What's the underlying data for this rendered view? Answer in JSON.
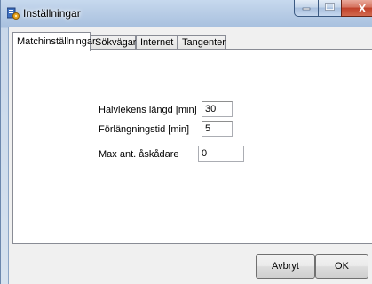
{
  "window": {
    "title": "Inställningar",
    "close_glyph": "X",
    "icons": {
      "app": "settings-app-icon",
      "minimize": "minimize-icon",
      "maximize": "maximize-icon",
      "close": "close-icon"
    }
  },
  "tabs": [
    {
      "label": "Matchinställningar",
      "active": true
    },
    {
      "label": "Sökvägar",
      "active": false
    },
    {
      "label": "Internet",
      "active": false
    },
    {
      "label": "Tangenter",
      "active": false
    }
  ],
  "fields": {
    "half_length": {
      "label": "Halvlekens längd [min]",
      "value": "30"
    },
    "overtime": {
      "label": "Förlängningstid [min]",
      "value": "5"
    },
    "max_spectators": {
      "label": "Max ant. åskådare",
      "value": "0"
    }
  },
  "buttons": {
    "cancel": "Avbryt",
    "ok": "OK"
  },
  "colors": {
    "close_button": "#c0412a",
    "titlebar": "#b9cde6",
    "panel": "#f0f0f0"
  }
}
